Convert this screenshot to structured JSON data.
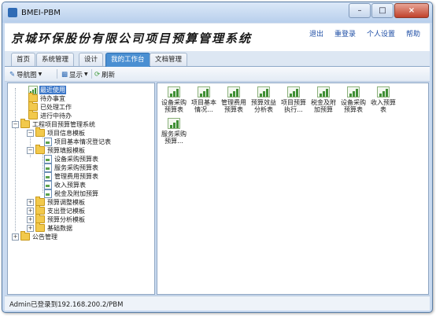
{
  "window": {
    "title": "BMEI-PBM"
  },
  "banner": {
    "company": "京城环保股份有限公司项目预算管理系统",
    "links": [
      "退出",
      "重登录",
      "个人设置",
      "帮助"
    ]
  },
  "tabs": [
    "首页",
    "系统管理",
    "设计",
    "我的工作台",
    "文档管理"
  ],
  "active_tab": "我的工作台",
  "toolbar": {
    "nav": "导航图",
    "display": "显示",
    "refresh": "刷新"
  },
  "tree": {
    "recent": "最近使用",
    "todo": "待办事宜",
    "done": "已处理工作",
    "in_progress": "进行中待办",
    "budget_mgmt": "工程项目预算管理系统",
    "info_template": "项目信息模板",
    "basic_info_form": "项目基本情况登记表",
    "fill_template": "预算填报模板",
    "fill_items": [
      "设备采购预算表",
      "服务采购预算表",
      "管理费用预算表",
      "收入预算表",
      "税金及附加预算"
    ],
    "adjust_template": "预算调整模板",
    "expense_template": "支出登记模板",
    "analysis_template": "预算分析模板",
    "base_data": "基础数据",
    "notice_mgmt": "公告管理"
  },
  "content": {
    "items": [
      "设备采购预算表",
      "项目基本情况...",
      "管理费用预算表",
      "预算效益分析表",
      "项目预算执行...",
      "税金及附加预算",
      "设备采购预算表",
      "收入预算表",
      "服务采购预算..."
    ]
  },
  "status": {
    "text": "Admin已登录到192.168.200.2/PBM"
  }
}
